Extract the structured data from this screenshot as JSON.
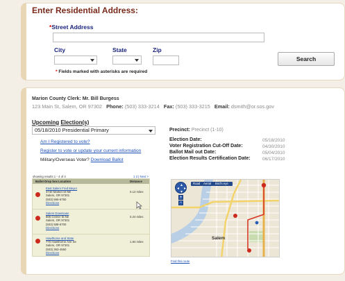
{
  "address_form": {
    "heading": "Enter Residential Address:",
    "street_label": "Street Address",
    "city_label": "City",
    "state_label": "State",
    "zip_label": "Zip",
    "search_label": "Search",
    "required_note": "Fields marked with asterisks are required"
  },
  "clerk": {
    "name_line": "Marion County Clerk: Mr. Bill Burgess",
    "address": "123 Main St, Salem, OR 97302",
    "phone_label": "Phone:",
    "phone": "(503) 333-3214",
    "fax_label": "Fax:",
    "fax": "(503) 333-3215",
    "email_label": "Email:",
    "email": "dsmith@or.sos.gov"
  },
  "elections": {
    "heading_upcoming": "Upcoming",
    "heading_elections": "Election(s)",
    "selected": "05/18/2010 Presidential Primary",
    "link_registered": "Am I Registered to vote?",
    "link_register": "Register to vote or update your current information",
    "military_label": "Military/Overseas Voter?",
    "military_link": "Download Ballot"
  },
  "precinct": {
    "label": "Precinct:",
    "value": "Precinct (1-10)",
    "dates": [
      {
        "label": "Election Date:",
        "value": "05/18/2010"
      },
      {
        "label": "Voter Registration Cut-Off Date:",
        "value": "04/30/2010"
      },
      {
        "label": "Ballot Mail out Date:",
        "value": "05/04/2010"
      },
      {
        "label": "Election Results Certification Date:",
        "value": "06/17/2010"
      }
    ]
  },
  "dropbox": {
    "showing": "showing results 1 - 4 of 4",
    "pager_prev": "1",
    "pager_next": "2 | Next >",
    "col_location": "Ballot Drop box Location",
    "col_distance": "Distance",
    "rows": [
      {
        "name": "East Salem Fred Meyer",
        "addr1": "3740 Market St NE",
        "addr2": "Salem, OR 97301",
        "phone": "(503) 566-6750",
        "link": "Directions",
        "distance": "0.12 miles"
      },
      {
        "name": "Salem Downtown",
        "addr1": "555 Center St Ne",
        "addr2": "Salem, OR 97301",
        "phone": "(503) 588-6700",
        "link": "Directions",
        "distance": "0.24 miles"
      },
      {
        "name": "Hawthorne and State",
        "addr1": "770 Hawthorne Ave Se",
        "addr2": "Salem, OR 97301",
        "phone": "(503) 363-4650",
        "link": "Directions",
        "distance": "1.84 miles"
      }
    ]
  },
  "map": {
    "tabs": [
      "Road",
      "Aerial",
      "Bird's eye"
    ],
    "city_label": "Salem",
    "footer_link": "Find this route"
  },
  "colors": {
    "heading": "#7a2a1a",
    "label_blue": "#1a237e",
    "required_red": "#d00",
    "link_blue": "#1a4fb8",
    "marker_red": "#cc2a1e"
  }
}
